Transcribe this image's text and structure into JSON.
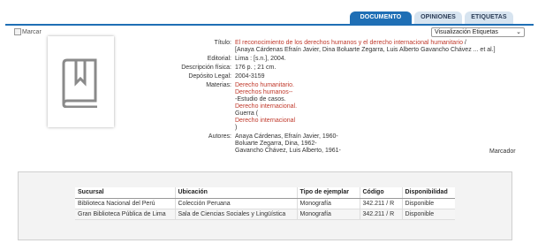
{
  "tabs": [
    {
      "label": "DOCUMENTO"
    },
    {
      "label": "OPINIONES"
    },
    {
      "label": "ETIQUETAS"
    }
  ],
  "marcar": {
    "label": "Marcar"
  },
  "view_select": {
    "value": "Visualización Etiquetas"
  },
  "record": {
    "titulo_label": "Título:",
    "titulo_link": "El reconocimiento de los derechos humanos y el derecho internacional humanitario",
    "titulo_sep": " /",
    "titulo_rest": "[Anaya Cárdenas Efraín Javier, Dina Boluarte Zegarra, Luis Alberto Gavancho Chávez ... et al.]",
    "editorial_label": "Editorial:",
    "editorial": "Lima : [s.n.], 2004.",
    "descripcion_label": "Descripción física:",
    "descripcion": "176 p. ; 21 cm.",
    "deposito_label": "Depósito Legal:",
    "deposito": "2004-3159",
    "materias_label": "Materias:",
    "materias": [
      {
        "text": "Derecho humanitario.",
        "red": true
      },
      {
        "text": "Derechos humanos-- -Estudio de casos.",
        "red": "partial",
        "red_part": "Derechos humanos--",
        "rest": " -Estudio de casos."
      },
      {
        "text": "Derecho internacional.",
        "red": true
      },
      {
        "text": "Guerra (Derecho internacional)",
        "red": "partial2",
        "pre": "Guerra (",
        "red_part": "Derecho internacional",
        "post": ")"
      }
    ],
    "autores_label": "Autores:",
    "autores": [
      "Anaya Cárdenas, Efraín Javier, 1960-",
      "Boluarte Zegarra, Dina, 1962-",
      "Gavancho Chávez, Luis Alberto, 1961-"
    ],
    "marcador": "Marcador"
  },
  "holdings": {
    "headers": [
      "Sucursal",
      "Ubicación",
      "Tipo de ejemplar",
      "Código",
      "Disponibilidad"
    ],
    "rows": [
      [
        "Biblioteca Nacional del Perú",
        "Colección Peruana",
        "Monografía",
        "342.211 / R",
        "Disponible"
      ],
      [
        "Gran Biblioteca Pública de Lima",
        "Sala de Ciencias Sociales y Lingüística",
        "Monografía",
        "342.211 / R",
        "Disponible"
      ]
    ]
  },
  "colors": {
    "accent": "#1f6fb5",
    "link_red": "#c0392b"
  }
}
